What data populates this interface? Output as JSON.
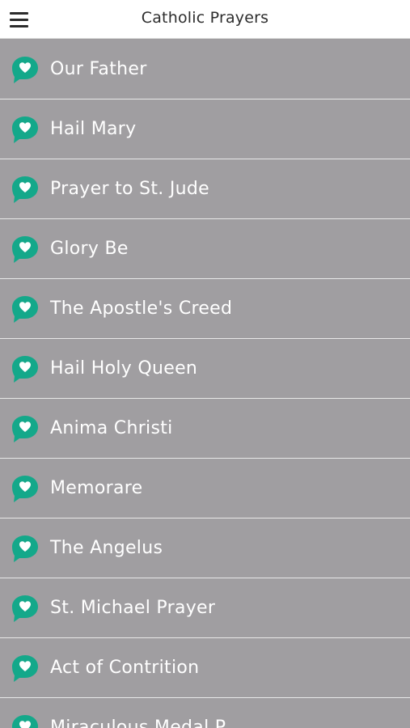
{
  "app": {
    "title": "Catholic Prayers",
    "accent_color": "#14a88a",
    "list_background": "#a09ea1"
  },
  "header": {
    "menu_icon": "hamburger-menu-icon",
    "title": "Catholic Prayers"
  },
  "prayers": [
    {
      "label": "Our Father",
      "icon": "heart-speech-bubble-icon"
    },
    {
      "label": "Hail Mary",
      "icon": "heart-speech-bubble-icon"
    },
    {
      "label": "Prayer to St. Jude",
      "icon": "heart-speech-bubble-icon"
    },
    {
      "label": "Glory Be",
      "icon": "heart-speech-bubble-icon"
    },
    {
      "label": "The Apostle's Creed",
      "icon": "heart-speech-bubble-icon"
    },
    {
      "label": "Hail Holy Queen",
      "icon": "heart-speech-bubble-icon"
    },
    {
      "label": "Anima Christi",
      "icon": "heart-speech-bubble-icon"
    },
    {
      "label": "Memorare",
      "icon": "heart-speech-bubble-icon"
    },
    {
      "label": "The Angelus",
      "icon": "heart-speech-bubble-icon"
    },
    {
      "label": "St. Michael Prayer",
      "icon": "heart-speech-bubble-icon"
    },
    {
      "label": "Act of Contrition",
      "icon": "heart-speech-bubble-icon"
    },
    {
      "label": "Miraculous Medal P",
      "icon": "heart-speech-bubble-icon"
    }
  ]
}
